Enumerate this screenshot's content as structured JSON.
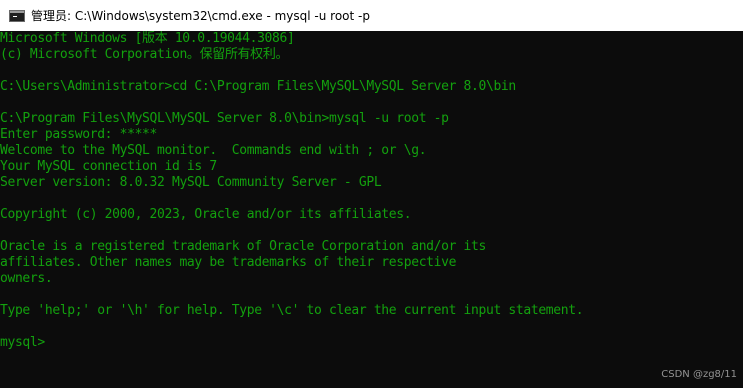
{
  "window": {
    "title": "管理员: C:\\Windows\\system32\\cmd.exe - mysql  -u root -p",
    "icon": "cmd-icon"
  },
  "console": {
    "lines": [
      "Microsoft Windows [版本 10.0.19044.3086]",
      "(c) Microsoft Corporation。保留所有权利。",
      "",
      "C:\\Users\\Administrator>cd C:\\Program Files\\MySQL\\MySQL Server 8.0\\bin",
      "",
      "C:\\Program Files\\MySQL\\MySQL Server 8.0\\bin>mysql -u root -p",
      "Enter password: *****",
      "Welcome to the MySQL monitor.  Commands end with ; or \\g.",
      "Your MySQL connection id is 7",
      "Server version: 8.0.32 MySQL Community Server - GPL",
      "",
      "Copyright (c) 2000, 2023, Oracle and/or its affiliates.",
      "",
      "Oracle is a registered trademark of Oracle Corporation and/or its",
      "affiliates. Other names may be trademarks of their respective",
      "owners.",
      "",
      "Type 'help;' or '\\h' for help. Type '\\c' to clear the current input statement.",
      "",
      "mysql>"
    ],
    "text_color": "#13a10e",
    "background": "#0c0c0c"
  },
  "watermark": "CSDN @zg8/11"
}
